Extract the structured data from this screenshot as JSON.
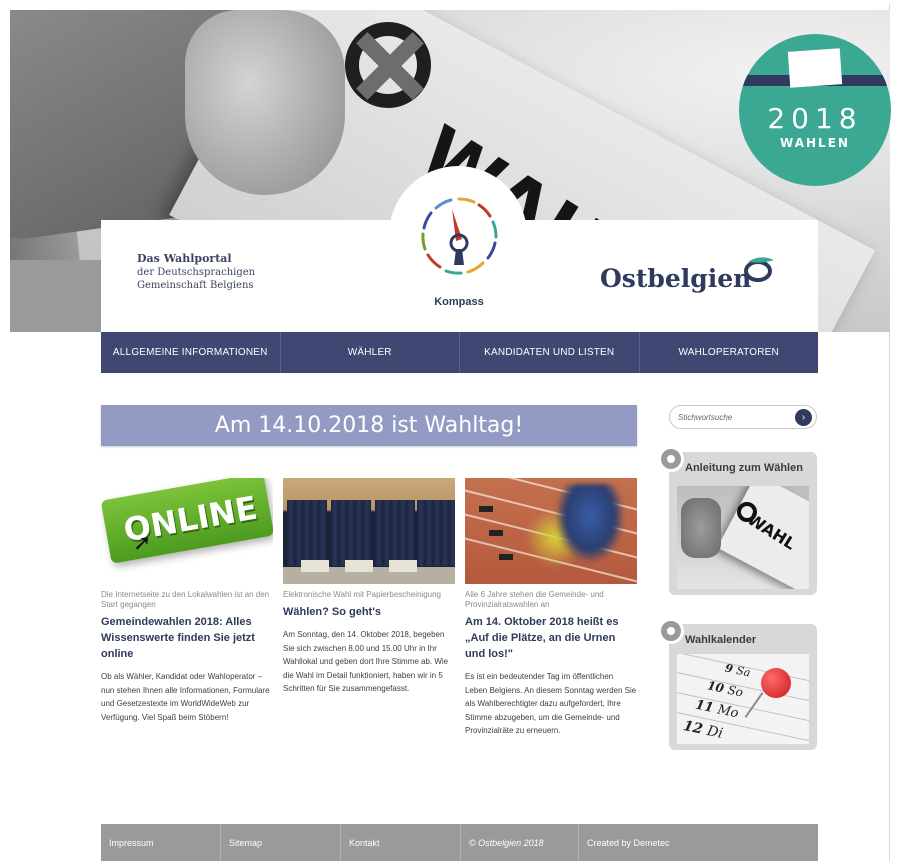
{
  "hero": {
    "ballot_word": "WAHL",
    "badge": {
      "year": "2018",
      "label": "WAHLEN"
    }
  },
  "branding": {
    "tagline_line1": "Das Wahlportal",
    "tagline_line2": "der Deutschsprachigen",
    "tagline_line3": "Gemeinschaft Belgiens",
    "compass_label": "Kompass",
    "brand_name": "Ostbelgien"
  },
  "nav": {
    "items": [
      {
        "label": "ALLGEMEINE INFORMATIONEN"
      },
      {
        "label": "WÄHLER"
      },
      {
        "label": "KANDIDATEN UND LISTEN"
      },
      {
        "label": "WAHLOPERATOREN"
      }
    ]
  },
  "banner": {
    "text": "Am 14.10.2018 ist Wahltag!"
  },
  "articles": [
    {
      "image_text": "ONLINE",
      "kicker": "Die Internetseite zu den Lokalwahlen ist an den Start gegangen",
      "headline": "Gemeindewahlen 2018: Alles Wissenswerte finden Sie jetzt online",
      "body": "Ob als Wähler, Kandidat oder Wahloperator – nun stehen Ihnen alle Informationen, Formulare und Gesetzestexte im WorldWideWeb zur Verfügung. Viel Spaß beim Stöbern!"
    },
    {
      "kicker": "Elektronische Wahl mit Papierbescheinigung",
      "headline": "Wählen? So geht's",
      "body": "Am Sonntag, den 14. Oktober 2018, begeben Sie sich zwischen 8.00 und 15.00 Uhr in Ihr Wahllokal und geben dort Ihre Stimme ab. Wie die Wahl im Detail funktioniert, haben wir in 5 Schritten für Sie zusammengefasst."
    },
    {
      "kicker": "Alle 6 Jahre stehen die Gemeinde- und Provinzialratswahlen an",
      "headline": "Am 14. Oktober 2018 heißt es „Auf die Plätze, an die Urnen und los!\"",
      "body": "Es ist ein bedeutender Tag im öffentlichen Leben Belgiens. An diesem Sonntag werden Sie als Wahlberechtigter dazu aufgefordert, Ihre Stimme abzugeben, um die Gemeinde- und Provinzialräte zu erneuern."
    }
  ],
  "sidebar": {
    "search_placeholder": "Stichwortsuche",
    "widgets": [
      {
        "title": "Anleitung zum Wählen",
        "image_text": "WAHL"
      },
      {
        "title": "Wahlkalender",
        "days": [
          {
            "num": "9",
            "day": "Sa"
          },
          {
            "num": "10",
            "day": "So"
          },
          {
            "num": "11",
            "day": "Mo"
          },
          {
            "num": "12",
            "day": "Di"
          }
        ]
      }
    ]
  },
  "footer": {
    "items": [
      {
        "label": "Impressum"
      },
      {
        "label": "Sitemap"
      },
      {
        "label": "Kontakt"
      },
      {
        "label": "© Ostbelgien 2018"
      },
      {
        "label": "Created by Demetec"
      }
    ]
  },
  "colors": {
    "nav_bg": "#3f4772",
    "banner_bg": "#939bc4",
    "headline": "#2f3a5c",
    "badge_green": "#3aa892",
    "footer_bg": "#9a9a9a"
  }
}
